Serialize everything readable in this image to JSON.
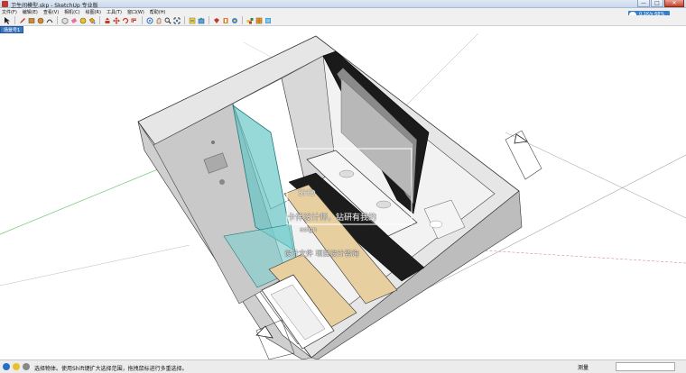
{
  "window": {
    "title": "卫生间模型.skp - SketchUp 专业版",
    "minimize": "—",
    "maximize": "□",
    "close": "✕"
  },
  "menu": [
    "文件(F)",
    "编辑(E)",
    "查看(V)",
    "相机(C)",
    "绘图(R)",
    "工具(T)",
    "窗口(W)",
    "帮助(H)"
  ],
  "network_badge": "0.1K/s 68%",
  "scene_tab": "场景号1",
  "watermark": {
    "line1": "SHD",
    "line2": "esign",
    "line3": "卡伴设计师，钻研有我的",
    "line4": "设计文件   项目设计咨询"
  },
  "statusbar": {
    "text": "选择物体。使用Shift键扩大选择范围，拖拽鼠标进行多重选择。",
    "measure_label": "测量",
    "measure_value": ""
  },
  "colors": {
    "glass": "#5fc4c4",
    "floor_wood": "#e8cfa0",
    "wall": "#d8d8d8",
    "accent": "#3b78c4"
  }
}
